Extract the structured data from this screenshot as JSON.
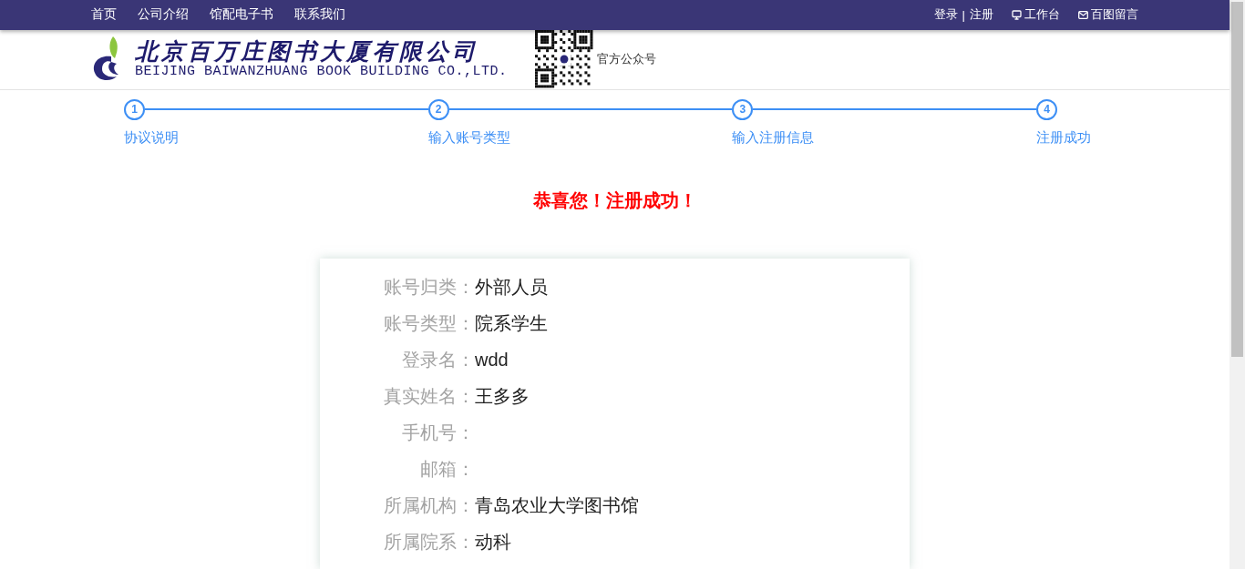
{
  "top_nav": {
    "links": [
      "首页",
      "公司介绍",
      "馆配电子书",
      "联系我们"
    ],
    "login": "登录",
    "separator": "|",
    "register": "注册",
    "workbench": "工作台",
    "message": "百图留言"
  },
  "header": {
    "logo_cn": "北京百万庄图书大厦有限公司",
    "logo_en": "BEIJING BAIWANZHUANG BOOK BUILDING CO.,LTD.",
    "qr_label": "官方公众号"
  },
  "steps": [
    {
      "number": "1",
      "label": "协议说明"
    },
    {
      "number": "2",
      "label": "输入账号类型"
    },
    {
      "number": "3",
      "label": "输入注册信息"
    },
    {
      "number": "4",
      "label": "注册成功"
    }
  ],
  "success_message": "恭喜您！注册成功！",
  "fields": [
    {
      "label": "账号归类：",
      "value": "外部人员"
    },
    {
      "label": "账号类型：",
      "value": "院系学生"
    },
    {
      "label": "登录名：",
      "value": "wdd"
    },
    {
      "label": "真实姓名：",
      "value": "王多多"
    },
    {
      "label": "手机号："
    },
    {
      "label": "邮箱："
    },
    {
      "label": "所属机构：",
      "value": "青岛农业大学图书馆"
    },
    {
      "label": "所属院系：",
      "value": "动科"
    }
  ]
}
